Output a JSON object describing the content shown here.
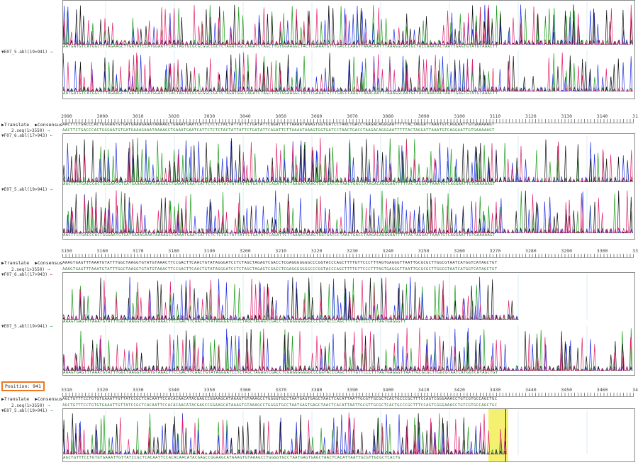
{
  "toolbar": {
    "translate": "▶Translate",
    "consensus": "▶Consensus"
  },
  "block1": {
    "reads": [
      {
        "label": "▼E07_5.abl(19>941)",
        "arrow": "→"
      }
    ],
    "seq_top": "AATGATGTCATGGCTTTAGAAGCTTGATATCCATGGAATTCACTAGTGCGCGCGGCCGCTCTAGATGGCCAGATCTAGCTTGTGGAAGGCTACTCGAAATGTTTGACCCAAGTTAAACAATTTAAAGGCAATGCTACCAAATACTAATTGAGTGTATGTAAACTT",
    "seq_bottom": "AATGATGTCATGGCTTTAGAAGCTTGATATCCATGGAATTCACTAGTGCGCGCGGCCGCTCTAGATGGCCAGATCTAGCTTGTGGAAGGCTACTCGAAATGTTTGACCCAAGTTAAACAATTTAAAGGCAATGCTACCAAATACTAATTGAGTGTATGTAAACTT"
  },
  "block2": {
    "ruler": [
      "2990",
      "3000",
      "3010",
      "3020",
      "3030",
      "3040",
      "3050",
      "3060",
      "3070",
      "3080",
      "3090",
      "3100",
      "3110",
      "3120",
      "3130",
      "3140",
      "3150"
    ],
    "consensus": "AACTTCTGACCCACTGGGAATGTGATGAAAGAAATAAAAGCTGAAATGAATCATTCTCTCTACTATTATTCTGATATTCAGATTCTTAAAATAAAGTGGTGATCCTAACTGACCTAAGACAGGGAATTTTTACTAGGATTAAATGTCAGGAATTGTGAAAAAGT",
    "reads": [
      {
        "label": "2.seq(1>3550)",
        "arrow": "→",
        "seq": "AACTTCTGACCCACTGGGAATGTGATGAAAGAAATAAAAGCTGAAATGAATCATTCTCTCTACTATTATTCTGATATTCAGATTCTTAAAATAAAGTGGTGATCCTAACTGACCTAAGACAGGGAATTTTTACTAGGATTAAATGTCAGGAATTGTGAAAAAGT"
      },
      {
        "label": "▼F07_6.abl(17>943)",
        "arrow": "←",
        "seq": "AACTTCTGACCCACTGGGAATGTGATGAAAGAAATAAAAGCTGAAATGAATCATTCTCTCTACTATTATTCTGATATTCAGATTCTTAAAATAAAGTGGTGATCCTAACTGACCTAAGACAGGGAATTTTTACTAGGATTAAATGTCAGGAATTGTGAAAAAGT"
      },
      {
        "label": "▼E07_5.abl(19>941)",
        "arrow": "→",
        "seq": "AACTTCTGACCCACTGGGAATGTGATGAAAGAAATAAAAGCTGAAATGAATCATTCTCTCTACTATTATTCTGATATTCAGATTCTTAAAATAAAGTGGTGATCCTAACTGACCTAAGACAGGGAATTTTTACTAGGATTAAATGTCAGGAATTGTGAAAAAGT"
      }
    ]
  },
  "block3": {
    "ruler": [
      "3150",
      "3160",
      "3170",
      "3180",
      "3190",
      "3200",
      "3210",
      "3220",
      "3230",
      "3240",
      "3250",
      "3260",
      "3270",
      "3280",
      "3290",
      "3300",
      "3310"
    ],
    "consensus": "AAAGTGAGTTTAAATGTATTTGGCTAAGGTGTATGTAAACTTCCGACTTCAACTGTATAGGGATCCTCTAGCTAGAGTCGACCTCGAGGGGGGGCCCGGTACCCAGCTTTTGTTCCCTTTAGTGAGGGTTAATTGCGCGCTTGGCGTAATCATGGTCATAGCTGT",
    "reads": [
      {
        "label": "2.seq(1>3550)",
        "arrow": "→",
        "seq": "AAAGTGAGTTTAAATGTATTTGGCTAAGGTGTATGTAAACTTCCGACTTCAACTGTATAGGGATCCTCTAGCTAGAGTCGACCTCGAGGGGGGGCCCGGTACCCAGCTTTTGTTCCCTTTAGTGAGGGTTAATTGCGCGCTTGGCGTAATCATGGTCATAGCTGT"
      },
      {
        "label": "▼F07_6.abl(17>943)",
        "arrow": "←",
        "seq": "AAAGTGAGTTTAAATGTATTTGGCTAAGGTGTATGTAAACTTCCGACTTCAACTGTATAGGGATCCTCTAGCTAGAGTCGACCTCGAGGGGGGGCCCGGTACCCAGCTTTTGTTCCCTTTAGTGAGGGTT"
      },
      {
        "label": "▼E07_5.abl(19>941)",
        "arrow": "→",
        "seq": "AAAGTGAGTTTAAATGTATTTGGCTAAGGTGTATGTAAACTTCCGACTTCAACTGTATAGGGATCCTCTAGCTAGAGTCGACCTCGAGGGGGGGCCCGGTACCCAGCTTTTGTTCCCTTTAGTGAGGGTTAATTGCGCGCTTGGCGTAATCATGGTCATAGCTGT"
      }
    ]
  },
  "position": "Position: 941",
  "block4": {
    "ruler": [
      "3310",
      "3320",
      "3330",
      "3340",
      "3350",
      "3360",
      "3370",
      "3380",
      "3390",
      "3400",
      "3410",
      "3420",
      "3430",
      "3440",
      "3450",
      "3460",
      "3470"
    ],
    "consensus": "AGCTGTTTCCTGTGTGAAATTGTTATCCGCTCACAATTCCACACAACATACGAGCCGGAAGCATAAAGTGTAAAGCCTGGGGTGCCTAATGAGTGAGCTAACTCACATTAATTGCGTTGCGCTCACTGCCCGCTTTCCAGTCGGGAAACCTGTCGTGCCAGCTGC",
    "reads": [
      {
        "label": "2.seq(1>3550)",
        "arrow": "→",
        "seq": "AGCTGTTTCCTGTGTGAAATTGTTATCCGCTCACAATTCCACACAACATACGAGCCGGAAGCATAAAGTGTAAAGCCTGGGGTGCCTAATGAGTGAGCTAACTCACATTAATTGCGTTGCGCTCACTGCCCGCTTTCCAGTCGGGAAACCTGTCGTGCCAGCTGC"
      },
      {
        "label": "▼E07_5.abl(19>941)",
        "arrow": "→",
        "seq": "AGCTGTTTCCTGTGTGAAATTGTTATCCGCTCACAATTCCACACAACATACGAGCCGGAAGCATAAAGTGTAAAGCCTGGGGTGCCTAATGAGTGAGCTAACTCACATTAATTGCGTTGCGCTCACTG"
      }
    ]
  },
  "colors": {
    "A": "#1a9a1a",
    "C": "#2030e0",
    "G": "#111111",
    "T": "#e0206a",
    "position_border": "#ee7722",
    "highlight": "#f4f060"
  }
}
